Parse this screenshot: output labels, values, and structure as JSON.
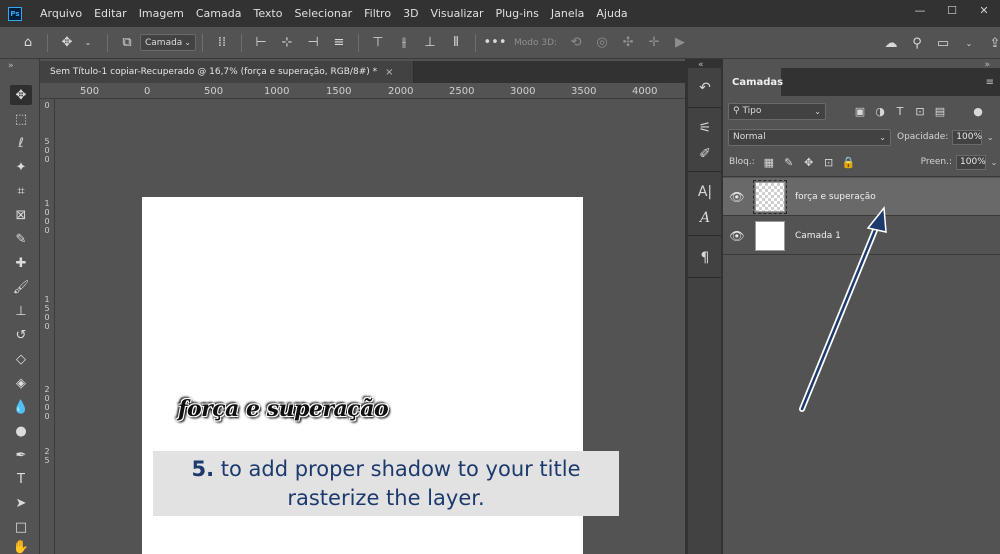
{
  "menubar": {
    "logo": "Ps",
    "items": [
      "Arquivo",
      "Editar",
      "Imagem",
      "Camada",
      "Texto",
      "Selecionar",
      "Filtro",
      "3D",
      "Visualizar",
      "Plug-ins",
      "Janela",
      "Ajuda"
    ],
    "minimize": "—",
    "maximize": "☐",
    "close": "✕"
  },
  "options": {
    "auto_select_target": "Camada",
    "mode3d_label": "Modo 3D:"
  },
  "document": {
    "tab_title": "Sem Título-1 copiar-Recuperado @ 16,7% (força e superação, RGB/8#) *",
    "close": "×",
    "title_text": "força e superação"
  },
  "rulers": {
    "top": [
      "500",
      "0",
      "500",
      "1000",
      "1500",
      "2000",
      "2500",
      "3000",
      "3500",
      "4000"
    ],
    "left": [
      "0",
      "5\n0\n0",
      "1\n0\n0\n0",
      "1\n5\n0\n0",
      "2\n0\n0\n0",
      "2\n5"
    ]
  },
  "layers_panel": {
    "tab_label": "Camadas",
    "filter_label": "Tipo",
    "blend_mode": "Normal",
    "opacity_label": "Opacidade:",
    "opacity_value": "100%",
    "lock_label": "Bloq.:",
    "fill_label": "Preen.:",
    "fill_value": "100%",
    "layers": [
      {
        "name": "força e superação",
        "selected": true,
        "thumb": "transparent"
      },
      {
        "name": "Camada 1",
        "selected": false,
        "thumb": "white"
      }
    ]
  },
  "callout": {
    "number": "5.",
    "line1": "to add proper shadow to your title",
    "line2": "rasterize the layer."
  },
  "colors": {
    "callout_text": "#1d3a6e",
    "callout_bg": "#e2e2e2",
    "arrow": "#1d3a6e",
    "selected_layer": "#696969"
  }
}
